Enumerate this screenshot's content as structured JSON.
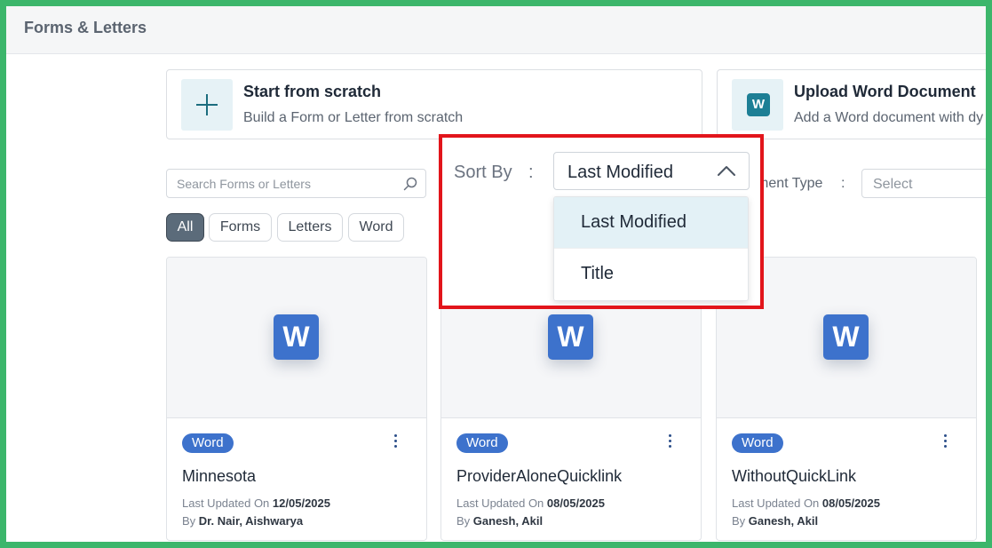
{
  "header": {
    "title": "Forms & Letters"
  },
  "actions": [
    {
      "title": "Start from scratch",
      "subtitle": "Build a Form or Letter from scratch",
      "icon": "plus-icon"
    },
    {
      "title": "Upload Word Document",
      "subtitle": "Add a Word document with dy",
      "icon": "word-icon",
      "icon_letter": "W"
    }
  ],
  "search": {
    "placeholder": "Search Forms or Letters"
  },
  "filters": {
    "chips": [
      "All",
      "Forms",
      "Letters",
      "Word"
    ],
    "active": "All"
  },
  "sort": {
    "label": "Sort By",
    "colon": ":",
    "selected": "Last Modified",
    "options": [
      "Last Modified",
      "Title"
    ],
    "open": true
  },
  "doc_type": {
    "label": "ment Type",
    "colon": ":",
    "placeholder": "Select"
  },
  "cards": [
    {
      "tag": "Word",
      "name": "Minnesota",
      "updated_label": "Last Updated On",
      "updated": "12/05/2025",
      "by_label": "By",
      "by": "Dr. Nair, Aishwarya",
      "icon_letter": "W"
    },
    {
      "tag": "Word",
      "name": "ProviderAloneQuicklink",
      "updated_label": "Last Updated On",
      "updated": "08/05/2025",
      "by_label": "By",
      "by": "Ganesh, Akil",
      "icon_letter": "W"
    },
    {
      "tag": "Word",
      "name": "WithoutQuickLink",
      "updated_label": "Last Updated On",
      "updated": "08/05/2025",
      "by_label": "By",
      "by": "Ganesh, Akil",
      "icon_letter": "W"
    }
  ],
  "colors": {
    "frame": "#3cb66b",
    "highlight": "#e2151b",
    "word_blue": "#3d72cc",
    "teal": "#1d7f95",
    "chip_active": "#5b6b7a"
  }
}
